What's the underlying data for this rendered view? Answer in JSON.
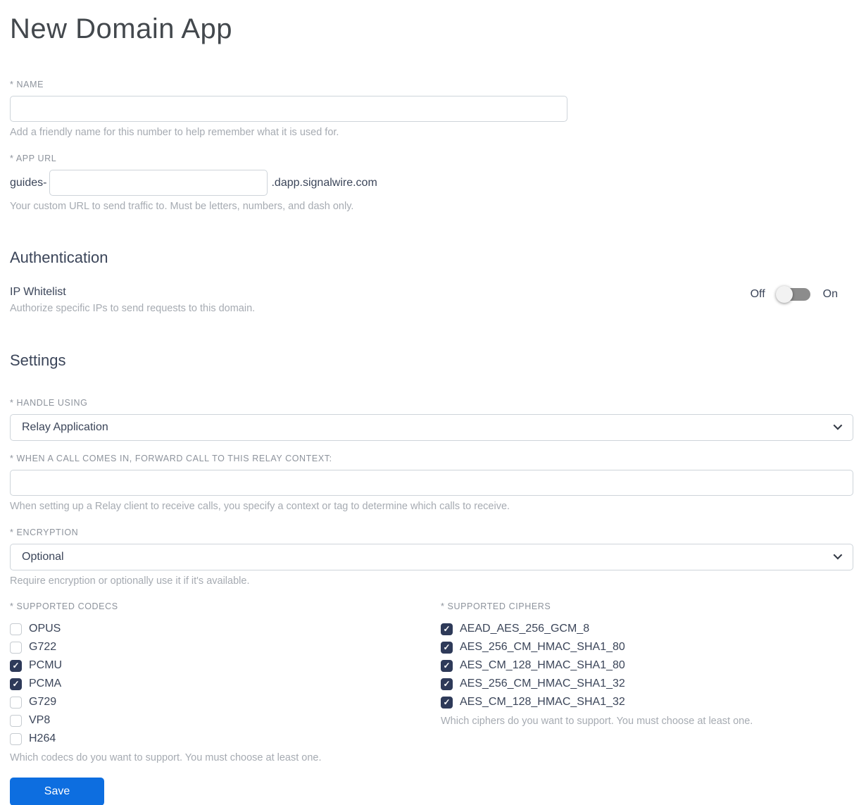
{
  "page": {
    "title": "New Domain App"
  },
  "name_field": {
    "label": "* NAME",
    "value": "",
    "helper": "Add a friendly name for this number to help remember what it is used for."
  },
  "app_url_field": {
    "label": "* APP URL",
    "prefix": "guides-",
    "value": "",
    "suffix": ".dapp.signalwire.com",
    "helper": "Your custom URL to send traffic to. Must be letters, numbers, and dash only."
  },
  "authentication": {
    "heading": "Authentication",
    "ip_whitelist": {
      "label": "IP Whitelist",
      "helper": "Authorize specific IPs to send requests to this domain.",
      "off_label": "Off",
      "on_label": "On",
      "state": "off"
    }
  },
  "settings": {
    "heading": "Settings",
    "handle_using": {
      "label": "* HANDLE USING",
      "selected": "Relay Application"
    },
    "relay_context": {
      "label": "* WHEN A CALL COMES IN, FORWARD CALL TO THIS RELAY CONTEXT:",
      "value": "",
      "helper": "When setting up a Relay client to receive calls, you specify a context or tag to determine which calls to receive."
    },
    "encryption": {
      "label": "* ENCRYPTION",
      "selected": "Optional",
      "helper": "Require encryption or optionally use it if it's available."
    },
    "codecs": {
      "label": "* SUPPORTED CODECS",
      "options": [
        {
          "label": "OPUS",
          "checked": false
        },
        {
          "label": "G722",
          "checked": false
        },
        {
          "label": "PCMU",
          "checked": true
        },
        {
          "label": "PCMA",
          "checked": true
        },
        {
          "label": "G729",
          "checked": false
        },
        {
          "label": "VP8",
          "checked": false
        },
        {
          "label": "H264",
          "checked": false
        }
      ],
      "helper": "Which codecs do you want to support. You must choose at least one."
    },
    "ciphers": {
      "label": "* SUPPORTED CIPHERS",
      "options": [
        {
          "label": "AEAD_AES_256_GCM_8",
          "checked": true
        },
        {
          "label": "AES_256_CM_HMAC_SHA1_80",
          "checked": true
        },
        {
          "label": "AES_CM_128_HMAC_SHA1_80",
          "checked": true
        },
        {
          "label": "AES_256_CM_HMAC_SHA1_32",
          "checked": true
        },
        {
          "label": "AES_CM_128_HMAC_SHA1_32",
          "checked": true
        }
      ],
      "helper": "Which ciphers do you want to support. You must choose at least one."
    }
  },
  "actions": {
    "save_label": "Save"
  },
  "colors": {
    "accent_blue": "#0d6ee0",
    "checkbox_checked": "#2e3a59",
    "text_dark": "#3b4559",
    "label_grey": "#8d939c",
    "helper_grey": "#a6abb2",
    "input_border": "#ced4da",
    "toggle_track": "#8c8c8c",
    "toggle_thumb": "#f2f2f2"
  }
}
